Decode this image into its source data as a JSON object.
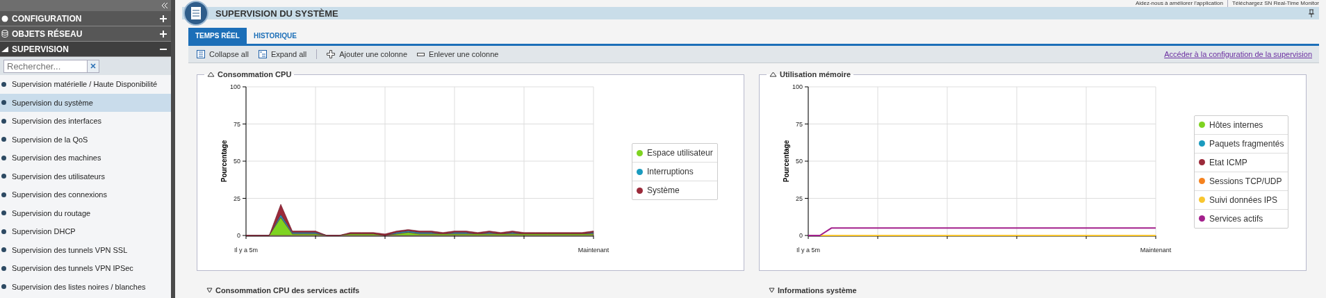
{
  "header": {
    "help_links": [
      "Aidez-nous à améliorer l'application",
      "Téléchargez SN Real-Time Monitor"
    ]
  },
  "sidebar": {
    "sections": [
      {
        "label": "CONFIGURATION",
        "kind": "circle",
        "expanded": false
      },
      {
        "label": "OBJETS RÉSEAU",
        "kind": "database",
        "expanded": false
      },
      {
        "label": "SUPERVISION",
        "kind": "chart",
        "expanded": true
      }
    ],
    "search": {
      "placeholder": "Rechercher..."
    },
    "items": [
      {
        "label": "Supervision matérielle / Haute Disponibilité",
        "selected": false
      },
      {
        "label": "Supervision du système",
        "selected": true
      },
      {
        "label": "Supervision des interfaces",
        "selected": false
      },
      {
        "label": "Supervision de la QoS",
        "selected": false
      },
      {
        "label": "Supervision des machines",
        "selected": false
      },
      {
        "label": "Supervision des utilisateurs",
        "selected": false
      },
      {
        "label": "Supervision des connexions",
        "selected": false
      },
      {
        "label": "Supervision du routage",
        "selected": false
      },
      {
        "label": "Supervision DHCP",
        "selected": false
      },
      {
        "label": "Supervision des tunnels VPN SSL",
        "selected": false
      },
      {
        "label": "Supervision des tunnels VPN IPSec",
        "selected": false
      },
      {
        "label": "Supervision des listes noires / blanches",
        "selected": false
      }
    ]
  },
  "page": {
    "title": "SUPERVISION DU SYSTÈME"
  },
  "tabs": [
    {
      "label": "TEMPS RÉEL",
      "selected": true
    },
    {
      "label": "HISTORIQUE",
      "selected": false
    }
  ],
  "toolbar": {
    "buttons": [
      {
        "label": "Collapse all",
        "kind": "collapse"
      },
      {
        "label": "Expand all",
        "kind": "expand"
      },
      {
        "label": "Ajouter une colonne",
        "kind": "add"
      },
      {
        "label": "Enlever une colonne",
        "kind": "remove"
      }
    ],
    "link": "Accéder à la configuration de la supervision"
  },
  "panels": [
    {
      "title": "Consommation CPU",
      "expanded": true,
      "chart_data": {
        "type": "area",
        "stacked": true,
        "grid": true,
        "ylabel": "Pourcentage",
        "ylim": [
          0,
          100
        ],
        "yticks": [
          0,
          25,
          50,
          75,
          100
        ],
        "categories": [
          "Il y a 5m",
          null,
          null,
          null,
          null,
          null,
          null,
          null,
          null,
          null,
          null,
          null,
          null,
          null,
          null,
          null,
          null,
          null,
          null,
          null,
          null,
          null,
          null,
          null,
          null,
          null,
          null,
          null,
          null,
          null,
          "Maintenant"
        ],
        "series": [
          {
            "name": "Espace utilisateur",
            "color": "#7ed321",
            "values": [
              0,
              0,
              0,
              12,
              1,
              1,
              1,
              0,
              0,
              1,
              1,
              1,
              0,
              1,
              2,
              1,
              1,
              1,
              1,
              1,
              1,
              1,
              1,
              1,
              1,
              1,
              1,
              1,
              1,
              1,
              1
            ]
          },
          {
            "name": "Interruptions",
            "color": "#1a9bbf",
            "values": [
              0,
              0,
              0,
              2,
              1,
              1,
              1,
              0,
              0,
              0,
              0,
              0,
              0,
              1,
              1,
              1,
              1,
              0,
              1,
              1,
              0,
              1,
              0,
              1,
              0,
              0,
              0,
              0,
              0,
              0,
              1
            ]
          },
          {
            "name": "Système",
            "color": "#9b2a3a",
            "values": [
              0,
              0,
              0,
              7,
              1,
              1,
              1,
              0,
              0,
              1,
              1,
              1,
              1,
              1,
              1,
              1,
              1,
              1,
              1,
              1,
              1,
              1,
              1,
              1,
              1,
              1,
              1,
              1,
              1,
              1,
              1
            ]
          }
        ]
      }
    },
    {
      "title": "Utilisation mémoire",
      "expanded": true,
      "chart_data": {
        "type": "line",
        "grid": true,
        "ylabel": "Pourcentage",
        "ylim": [
          0,
          100
        ],
        "yticks": [
          0,
          25,
          50,
          75,
          100
        ],
        "categories": [
          "Il y a 5m",
          null,
          null,
          null,
          null,
          null,
          null,
          null,
          null,
          null,
          null,
          null,
          null,
          null,
          null,
          null,
          null,
          null,
          null,
          null,
          null,
          null,
          null,
          null,
          null,
          null,
          null,
          null,
          null,
          null,
          "Maintenant"
        ],
        "series": [
          {
            "name": "Hôtes internes",
            "color": "#7ed321",
            "values": [
              null,
              null,
              null,
              null,
              null,
              null,
              null,
              null,
              null,
              null,
              null,
              null,
              null,
              null,
              null,
              null,
              null,
              null,
              null,
              null,
              null,
              null,
              null,
              null,
              null,
              null,
              null,
              null,
              null,
              null,
              null
            ]
          },
          {
            "name": "Paquets fragmentés",
            "color": "#1a9bbf",
            "values": [
              null,
              null,
              null,
              null,
              null,
              null,
              null,
              null,
              null,
              null,
              null,
              null,
              null,
              null,
              null,
              null,
              null,
              null,
              null,
              null,
              null,
              null,
              null,
              null,
              null,
              null,
              null,
              null,
              null,
              null,
              null
            ]
          },
          {
            "name": "Etat ICMP",
            "color": "#9b2a3a",
            "values": [
              null,
              null,
              null,
              null,
              null,
              null,
              null,
              null,
              null,
              null,
              null,
              null,
              null,
              null,
              null,
              null,
              null,
              null,
              null,
              null,
              null,
              null,
              null,
              null,
              null,
              null,
              null,
              null,
              null,
              null,
              null
            ]
          },
          {
            "name": "Sessions TCP/UDP",
            "color": "#f5821f",
            "values": [
              null,
              null,
              null,
              null,
              null,
              null,
              null,
              null,
              null,
              null,
              null,
              null,
              null,
              null,
              null,
              null,
              null,
              null,
              null,
              null,
              null,
              null,
              null,
              null,
              null,
              null,
              null,
              null,
              null,
              null,
              null
            ]
          },
          {
            "name": "Suivi données IPS",
            "color": "#f8c630",
            "values": [
              null,
              0,
              0,
              0,
              0,
              0,
              0,
              0,
              0,
              0,
              0,
              0,
              0,
              0,
              0,
              0,
              0,
              0,
              0,
              0,
              0,
              0,
              0,
              0,
              0,
              0,
              0,
              0,
              0,
              0,
              0
            ]
          },
          {
            "name": "Services actifs",
            "color": "#a3208c",
            "values": [
              0,
              0,
              5,
              5,
              5,
              5,
              5,
              5,
              5,
              5,
              5,
              5,
              5,
              5,
              5,
              5,
              5,
              5,
              5,
              5,
              5,
              5,
              5,
              5,
              5,
              5,
              5,
              5,
              5,
              5,
              5
            ]
          }
        ]
      }
    },
    {
      "title": "Consommation CPU des services actifs",
      "expanded": false
    },
    {
      "title": "Informations système",
      "expanded": false
    }
  ]
}
